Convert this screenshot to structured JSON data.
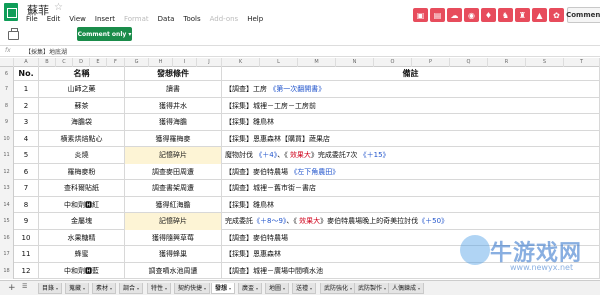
{
  "doc": {
    "title": "蘇菲"
  },
  "menu": [
    "File",
    "Edit",
    "View",
    "Insert",
    "Format",
    "Data",
    "Tools",
    "Add-ons",
    "Help"
  ],
  "menu_disabled": [
    false,
    false,
    false,
    false,
    true,
    false,
    false,
    true,
    false
  ],
  "toolbar": {
    "comment_only": "Comment only",
    "comments": "Comments"
  },
  "formula": {
    "fx": "fx",
    "value": "【採集】地底湖"
  },
  "columns": [
    "A",
    "B",
    "C",
    "D",
    "E",
    "F",
    "G",
    "H",
    "I",
    "J",
    "K",
    "L",
    "M",
    "N",
    "O",
    "P",
    "Q",
    "R",
    "S",
    "T"
  ],
  "header": {
    "rownum": "6",
    "no": "No.",
    "name": "名稱",
    "cond": "發想條件",
    "note": "備註"
  },
  "rows": [
    {
      "rownum": "7",
      "no": "1",
      "name": "山師之藥",
      "cond": "讀書",
      "note": [
        {
          "t": "【調查】工房 "
        },
        {
          "t": "《第一次翻開書》",
          "c": "blue"
        }
      ]
    },
    {
      "rownum": "8",
      "no": "2",
      "name": "蘇茶",
      "cond": "獲得井水",
      "note": [
        {
          "t": "【採集】城裡－工房－工房前"
        }
      ]
    },
    {
      "rownum": "9",
      "no": "3",
      "name": "海膽袋",
      "cond": "獲得海膽",
      "note": [
        {
          "t": "【採集】雛鳥林"
        }
      ]
    },
    {
      "rownum": "10",
      "no": "4",
      "name": "横素烘焙點心",
      "cond": "獲得羅梅麥",
      "note": [
        {
          "t": "【採集】恩惠森林【購買】蔬果店"
        }
      ]
    },
    {
      "rownum": "11",
      "no": "5",
      "name": "炎燒",
      "cond": "記憶碎片",
      "hl": true,
      "note": [
        {
          "t": "魔物討伐 "
        },
        {
          "t": "《＋4》",
          "c": "blue"
        },
        {
          "t": "、《 "
        },
        {
          "t": "效果大",
          "c": "red"
        },
        {
          "t": "》完成委託7次 "
        },
        {
          "t": "《＋15》",
          "c": "blue"
        }
      ]
    },
    {
      "rownum": "12",
      "no": "6",
      "name": "羅梅麥粉",
      "cond": "調查麥田周遭",
      "note": [
        {
          "t": "【調查】麥伯特農場 "
        },
        {
          "t": "《左下角農田》",
          "c": "blue"
        }
      ]
    },
    {
      "rownum": "13",
      "no": "7",
      "name": "查科爾貼紙",
      "cond": "調查書架周遭",
      "note": [
        {
          "t": "【調查】城裡－舊市街－書店"
        }
      ]
    },
    {
      "rownum": "14",
      "no": "8",
      "name": "中和劑🅷紅",
      "cond": "獲得紅海膽",
      "note": [
        {
          "t": "【採集】雛鳥林"
        }
      ]
    },
    {
      "rownum": "15",
      "no": "9",
      "name": "金屬塊",
      "cond": "記憶碎片",
      "hl": true,
      "note": [
        {
          "t": "完成委託"
        },
        {
          "t": "《＋8～9》",
          "c": "blue"
        },
        {
          "t": "、《 "
        },
        {
          "t": "效果大",
          "c": "red"
        },
        {
          "t": "》麥伯特農場晚上的奇美拉討伐"
        },
        {
          "t": "《＋50》",
          "c": "blue"
        }
      ]
    },
    {
      "rownum": "16",
      "no": "10",
      "name": "水果糖精",
      "cond": "獲得隨興草莓",
      "note": [
        {
          "t": "【調查】麥伯特農場"
        }
      ]
    },
    {
      "rownum": "17",
      "no": "11",
      "name": "蜂蜜",
      "cond": "獲得蜂巢",
      "note": [
        {
          "t": "【採集】恩惠森林"
        }
      ]
    },
    {
      "rownum": "18",
      "no": "12",
      "name": "中和劑🅷藍",
      "cond": "調查噴水池周遭",
      "note": [
        {
          "t": "【調查】城裡－廣場中間噴水池"
        }
      ]
    }
  ],
  "tabs": {
    "add": "+",
    "list": "☰",
    "items": [
      "目錄",
      "蒐藏",
      "素材",
      "調合",
      "特性",
      "契約快捷",
      "發想",
      "廣盃",
      "地圖",
      "送禮",
      "武防強化",
      "武防製作",
      "人偶鍊成"
    ],
    "active_index": 6
  },
  "watermark": {
    "text": "牛游戏网",
    "url": "www.newyx.net"
  },
  "colors": {
    "accent": "#1a8c4a",
    "highlight": "#fdf4d5",
    "link_blue": "#2255cc",
    "red": "#d0021b"
  }
}
